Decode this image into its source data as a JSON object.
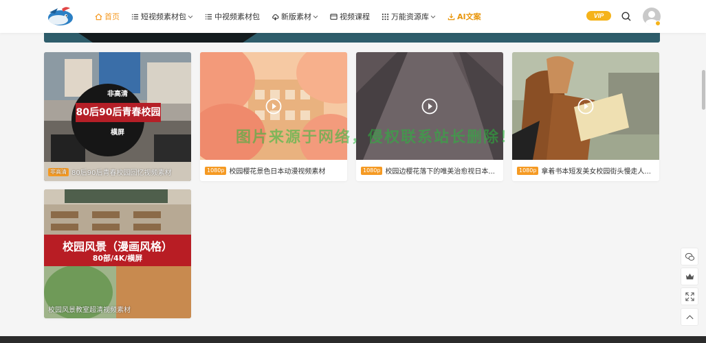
{
  "nav": {
    "items": [
      {
        "label": "首页",
        "icon": "home-icon",
        "active": true
      },
      {
        "label": "短视频素材包",
        "icon": "list-icon",
        "dropdown": true
      },
      {
        "label": "中视频素材包",
        "icon": "list-icon"
      },
      {
        "label": "新版素材",
        "icon": "cloud-icon",
        "dropdown": true
      },
      {
        "label": "视频课程",
        "icon": "video-icon"
      },
      {
        "label": "万能资源库",
        "icon": "grid-icon",
        "dropdown": true
      },
      {
        "label": "AI文案",
        "icon": "download-icon"
      }
    ]
  },
  "header": {
    "vip_label": "VIP"
  },
  "cards": [
    {
      "badge": "非高清",
      "title": "80后90后青春校园回忆视频素材",
      "thumb_top": "非高清",
      "thumb_band": "80后90后青春校园",
      "thumb_bottom": "横屏"
    },
    {
      "badge": "1080p",
      "title": "校园樱花景色日本动漫视频素材"
    },
    {
      "badge": "1080p",
      "title": "校园边樱花落下的唯美治愈视日本..."
    },
    {
      "badge": "1080p",
      "title": "拿着书本短发美女校园街头慢走人..."
    },
    {
      "title": "校园风景教室超清视频素材",
      "thumb_title": "校园风景（漫画风格）",
      "thumb_sub": "80部/4K/横屏"
    }
  ],
  "watermark": "图片来源于网络，侵权联系站长删除！",
  "colors": {
    "accent": "#f59a23",
    "vip": "#f5b31a",
    "band_red": "#b51f27"
  }
}
